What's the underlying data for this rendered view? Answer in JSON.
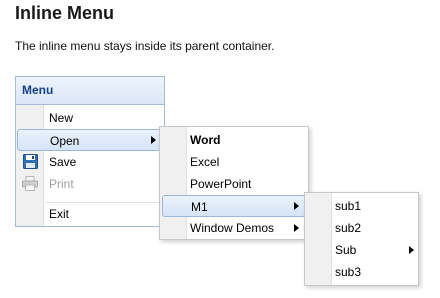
{
  "page": {
    "title": "Inline Menu",
    "description": "The inline menu stays inside its parent container."
  },
  "panel": {
    "title": "Menu"
  },
  "menu": {
    "items": [
      {
        "label": "New",
        "icon": "none"
      },
      {
        "label": "Open",
        "has_submenu": true,
        "active": true
      },
      {
        "label": "Save",
        "icon": "floppy-disk-icon"
      },
      {
        "label": "Print",
        "icon": "printer-icon",
        "disabled": true
      },
      {
        "label": "Exit"
      }
    ]
  },
  "open_submenu": {
    "items": [
      {
        "label": "Word",
        "bold": true
      },
      {
        "label": "Excel"
      },
      {
        "label": "PowerPoint"
      },
      {
        "label": "M1",
        "has_submenu": true,
        "active": true
      },
      {
        "label": "Window Demos",
        "has_submenu": true
      }
    ]
  },
  "m1_submenu": {
    "items": [
      {
        "label": "sub1"
      },
      {
        "label": "sub2"
      },
      {
        "label": "Sub",
        "has_submenu": true
      },
      {
        "label": "sub3"
      }
    ]
  },
  "colors": {
    "header_text": "#15428b",
    "border": "#a3bad9",
    "highlight_border": "#9ab7e1",
    "disabled_text": "#a0a0a0"
  }
}
